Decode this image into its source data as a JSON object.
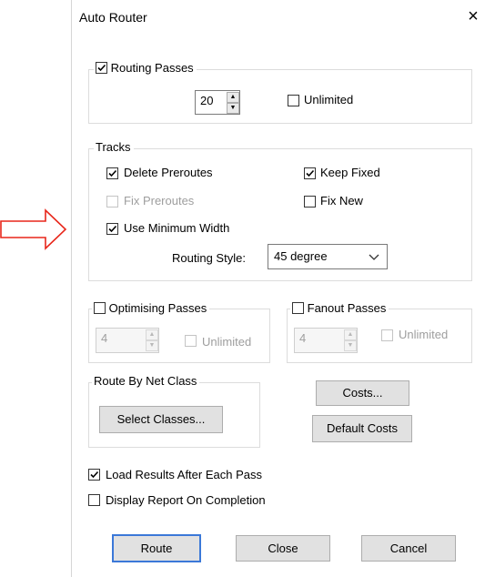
{
  "window": {
    "title": "Auto Router",
    "close_glyph": "×"
  },
  "routing_passes": {
    "label": "Routing Passes",
    "checked": true,
    "value": "20",
    "unlimited_label": "Unlimited",
    "unlimited_checked": false
  },
  "tracks": {
    "label": "Tracks",
    "delete_preroutes": {
      "label": "Delete Preroutes",
      "checked": true
    },
    "keep_fixed": {
      "label": "Keep Fixed",
      "checked": true
    },
    "fix_preroutes": {
      "label": "Fix Preroutes",
      "checked": false,
      "disabled": true
    },
    "fix_new": {
      "label": "Fix New",
      "checked": false
    },
    "use_minimum_width": {
      "label": "Use Minimum Width",
      "checked": true
    },
    "routing_style_label": "Routing Style:",
    "routing_style_value": "45 degree"
  },
  "optimising_passes": {
    "label": "Optimising Passes",
    "checked": false,
    "value": "4",
    "unlimited_label": "Unlimited"
  },
  "fanout_passes": {
    "label": "Fanout Passes",
    "checked": false,
    "value": "4",
    "unlimited_label": "Unlimited"
  },
  "route_by_net_class": {
    "label": "Route By Net Class",
    "select_button": "Select Classes..."
  },
  "costs_button": "Costs...",
  "default_costs_button": "Default Costs",
  "load_results": {
    "label": "Load Results After Each Pass",
    "checked": true
  },
  "display_report": {
    "label": "Display Report On Completion",
    "checked": false
  },
  "buttons": {
    "route": "Route",
    "close": "Close",
    "cancel": "Cancel"
  },
  "icons": {
    "annotation_arrow": "right-arrow-outline",
    "check": "checkmark-icon"
  },
  "colors": {
    "annotation_arrow": "#e8261a",
    "default_button_border": "#3b78d8",
    "disabled_text": "#9e9e9e"
  }
}
